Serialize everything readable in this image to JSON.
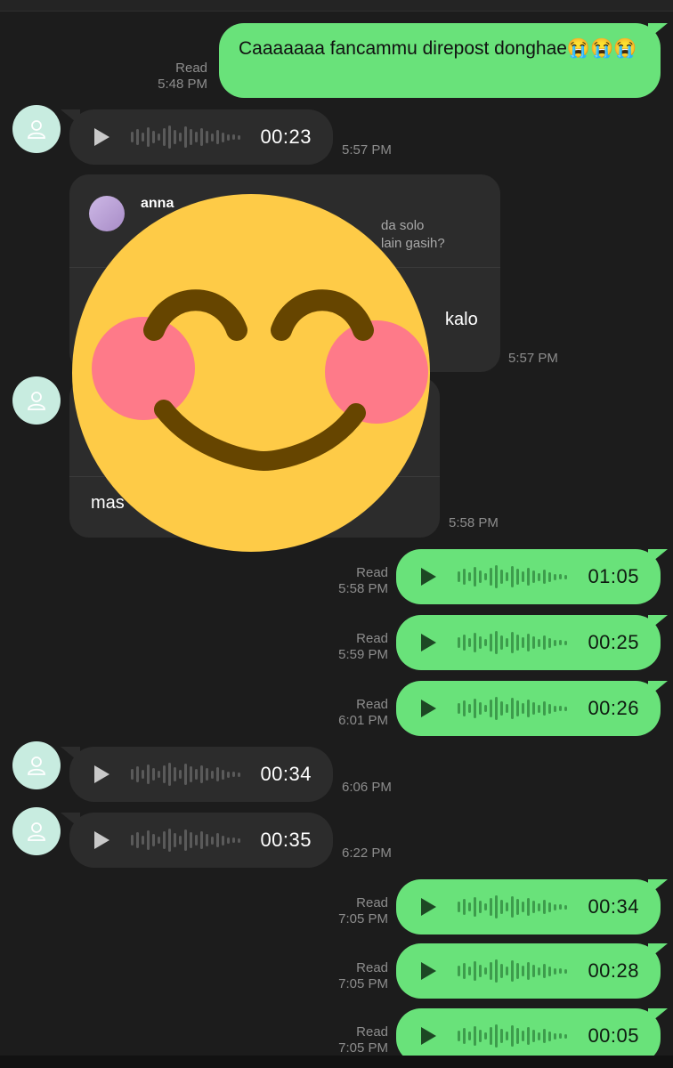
{
  "messages": {
    "m1": {
      "text": "Caaaaaaa fancammu direpost donghae😭😭😭",
      "status": "Read",
      "time": "5:48 PM"
    },
    "m2": {
      "duration": "00:23",
      "time": "5:57 PM"
    },
    "m3": {
      "quote_name": "anna",
      "quote_line1": "da solo",
      "quote_line2": "lain gasih?",
      "reply_text": "kalo",
      "time": "5:57 PM"
    },
    "m4": {
      "reply_text": "mas",
      "time": "5:58 PM"
    },
    "m5": {
      "duration": "01:05",
      "status": "Read",
      "time": "5:58 PM"
    },
    "m6": {
      "duration": "00:25",
      "status": "Read",
      "time": "5:59 PM"
    },
    "m7": {
      "duration": "00:26",
      "status": "Read",
      "time": "6:01 PM"
    },
    "m8": {
      "duration": "00:34",
      "time": "6:06 PM"
    },
    "m9": {
      "duration": "00:35",
      "time": "6:22 PM"
    },
    "m10": {
      "duration": "00:34",
      "status": "Read",
      "time": "7:05 PM"
    },
    "m11": {
      "duration": "00:28",
      "status": "Read",
      "time": "7:05 PM"
    },
    "m12": {
      "duration": "00:05",
      "status": "Read",
      "time": "7:05 PM"
    }
  },
  "sticker": {
    "icon": "smiling-face-with-blush-emoji"
  },
  "colors": {
    "outgoing": "#69e27a",
    "incoming": "#2c2c2c",
    "background": "#1c1c1c",
    "avatar": "#c8ece0"
  }
}
